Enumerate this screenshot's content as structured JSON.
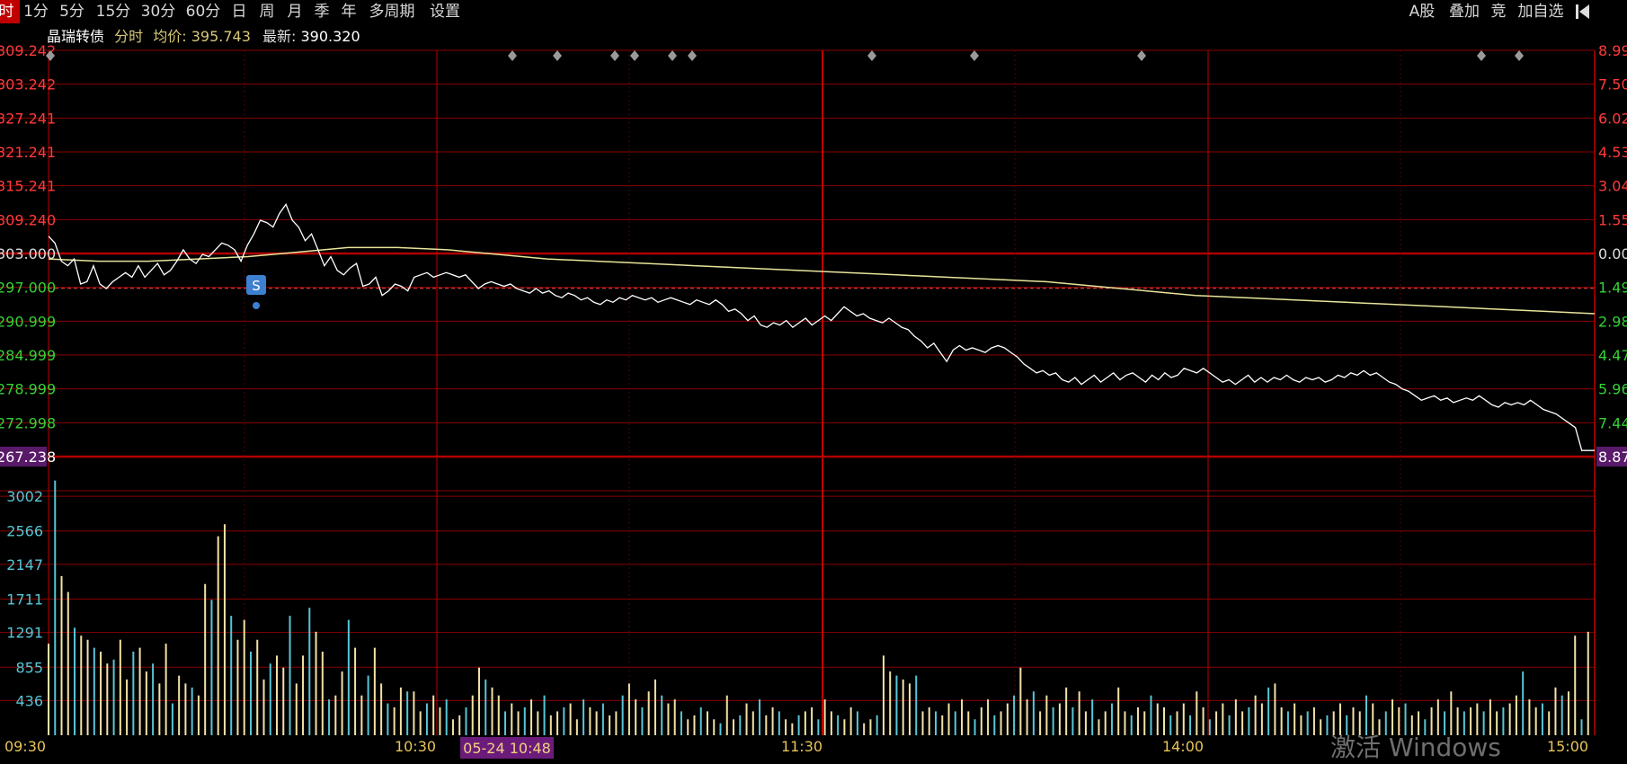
{
  "toolbar": {
    "left": [
      "时",
      "1分",
      "5分",
      "15分",
      "30分",
      "60分",
      "日",
      "周",
      "月",
      "季",
      "年",
      "多周期",
      "设置"
    ],
    "right": [
      "A股",
      "叠加",
      "竞",
      "加自选"
    ],
    "back_icon": "back-to-start-icon"
  },
  "info": {
    "name": "晶瑞转债",
    "mode": "分时",
    "avg_label": "均价:",
    "avg_value": "395.743",
    "last_label": "最新:",
    "last_value": "390.320"
  },
  "badges": {
    "cursor_time": "05-24 10:48",
    "signal": "S"
  },
  "watermark": "激活 Windows",
  "colors": {
    "background": "#000000",
    "grid": "#8b0000",
    "price": "#ffffff",
    "avg": "#e8e49a",
    "up": "#ff3b3b",
    "down": "#35d235",
    "vol_up": "#f3e2a6",
    "vol_down": "#57c6d6"
  },
  "chart_data": {
    "type": "line",
    "price_axis": {
      "ticks": [
        "309.242",
        "303.242",
        "327.241",
        "321.241",
        "315.241",
        "309.240",
        "303.000",
        "297.000",
        "290.999",
        "284.999",
        "278.999",
        "272.998",
        "267.238"
      ],
      "pct_ticks": [
        "8.99",
        "7.50",
        "6.02",
        "4.53",
        "3.04",
        "1.55",
        "0.00",
        "1.49",
        "2.98",
        "4.47",
        "5.96",
        "7.44",
        "8.87"
      ],
      "ylim": [
        -8.87,
        8.99
      ]
    },
    "x_ticks": [
      "09:30",
      "10:30",
      "11:30",
      "14:00",
      "15:00"
    ],
    "volume_ticks": [
      "436",
      "855",
      "1291",
      "1711",
      "2147",
      "2566",
      "3002"
    ],
    "volume_ylim": [
      0,
      3500
    ],
    "series": [
      {
        "name": "分时",
        "values": [
          0.8,
          0.5,
          -0.3,
          -0.5,
          -0.2,
          -1.3,
          -1.2,
          -0.5,
          -1.3,
          -1.5,
          -1.2,
          -1.0,
          -0.8,
          -1.0,
          -0.5,
          -1.0,
          -0.7,
          -0.4,
          -0.9,
          -0.7,
          -0.3,
          0.2,
          -0.2,
          -0.4,
          0.0,
          -0.1,
          0.2,
          0.5,
          0.4,
          0.2,
          -0.3,
          0.4,
          0.9,
          1.5,
          1.4,
          1.2,
          1.8,
          2.2,
          1.5,
          1.2,
          0.6,
          0.9,
          0.2,
          -0.5,
          -0.1,
          -0.7,
          -0.9,
          -0.6,
          -0.4,
          -1.4,
          -1.3,
          -1.0,
          -1.8,
          -1.6,
          -1.3,
          -1.4,
          -1.6,
          -1.0,
          -0.9,
          -0.8,
          -1.0,
          -0.9,
          -0.8,
          -0.9,
          -1.0,
          -0.9,
          -1.2,
          -1.5,
          -1.3,
          -1.2,
          -1.3,
          -1.4,
          -1.3,
          -1.5,
          -1.6,
          -1.7,
          -1.5,
          -1.7,
          -1.6,
          -1.8,
          -1.9,
          -1.7,
          -1.8,
          -2.0,
          -1.9,
          -2.1,
          -2.2,
          -2.0,
          -2.1,
          -1.9,
          -2.0,
          -1.8,
          -1.9,
          -2.0,
          -1.9,
          -2.1,
          -2.0,
          -1.9,
          -2.0,
          -2.1,
          -2.2,
          -2.0,
          -2.1,
          -2.2,
          -2.0,
          -2.2,
          -2.5,
          -2.4,
          -2.6,
          -2.9,
          -2.7,
          -3.1,
          -3.2,
          -3.0,
          -3.1,
          -2.9,
          -3.2,
          -3.0,
          -2.8,
          -3.1,
          -2.9,
          -2.7,
          -2.9,
          -2.6,
          -2.3,
          -2.5,
          -2.7,
          -2.6,
          -2.8,
          -2.9,
          -3.0,
          -2.8,
          -3.0,
          -3.2,
          -3.3,
          -3.6,
          -3.8,
          -4.1,
          -3.9,
          -4.3,
          -4.7,
          -4.2,
          -4.0,
          -4.2,
          -4.1,
          -4.2,
          -4.3,
          -4.1,
          -4.0,
          -4.1,
          -4.3,
          -4.5,
          -4.8,
          -5.0,
          -5.2,
          -5.1,
          -5.3,
          -5.2,
          -5.5,
          -5.6,
          -5.4,
          -5.7,
          -5.5,
          -5.3,
          -5.6,
          -5.4,
          -5.2,
          -5.5,
          -5.3,
          -5.2,
          -5.4,
          -5.6,
          -5.3,
          -5.5,
          -5.2,
          -5.4,
          -5.3,
          -5.0,
          -5.1,
          -5.2,
          -5.0,
          -5.2,
          -5.4,
          -5.6,
          -5.5,
          -5.7,
          -5.5,
          -5.3,
          -5.6,
          -5.4,
          -5.6,
          -5.4,
          -5.5,
          -5.3,
          -5.5,
          -5.6,
          -5.4,
          -5.5,
          -5.4,
          -5.6,
          -5.5,
          -5.3,
          -5.4,
          -5.2,
          -5.3,
          -5.1,
          -5.3,
          -5.2,
          -5.4,
          -5.6,
          -5.7,
          -5.9,
          -6.0,
          -6.2,
          -6.4,
          -6.3,
          -6.2,
          -6.4,
          -6.3,
          -6.5,
          -6.4,
          -6.3,
          -6.4,
          -6.2,
          -6.4,
          -6.6,
          -6.7,
          -6.5,
          -6.6,
          -6.5,
          -6.6,
          -6.4,
          -6.6,
          -6.8,
          -6.9,
          -7.0,
          -7.2,
          -7.4,
          -7.6,
          -8.6,
          -8.6,
          -8.6
        ],
        "role": "price"
      },
      {
        "name": "均价",
        "values": [
          -0.2,
          -0.3,
          -0.3,
          -0.2,
          -0.1,
          0.1,
          0.3,
          0.3,
          0.2,
          0.0,
          -0.2,
          -0.3,
          -0.4,
          -0.5,
          -0.6,
          -0.7,
          -0.8,
          -0.9,
          -1.0,
          -1.1,
          -1.2,
          -1.4,
          -1.6,
          -1.8,
          -1.9,
          -2.0,
          -2.1,
          -2.2,
          -2.3,
          -2.4,
          -2.5,
          -2.6
        ],
        "role": "avg"
      },
      {
        "name": "成交量",
        "role": "volume",
        "values": [
          1150,
          3200,
          2000,
          1800,
          1350,
          1250,
          1200,
          1100,
          1050,
          900,
          950,
          1200,
          700,
          1050,
          1100,
          800,
          900,
          650,
          1150,
          400,
          750,
          650,
          600,
          500,
          1900,
          1700,
          2500,
          2650,
          1500,
          1200,
          1450,
          1050,
          1200,
          700,
          900,
          1000,
          850,
          1500,
          650,
          1000,
          1600,
          1300,
          1050,
          450,
          500,
          800,
          1450,
          1100,
          500,
          750,
          1100,
          650,
          400,
          350,
          600,
          550,
          550,
          300,
          400,
          500,
          350,
          450,
          200,
          250,
          350,
          500,
          850,
          700,
          600,
          500,
          300,
          400,
          300,
          350,
          450,
          300,
          500,
          250,
          300,
          350,
          400,
          200,
          450,
          350,
          300,
          400,
          250,
          300,
          500,
          650,
          450,
          350,
          550,
          700,
          500,
          400,
          450,
          300,
          200,
          250,
          350,
          300,
          200,
          150,
          500,
          200,
          250,
          400,
          300,
          450,
          250,
          350,
          300,
          200,
          150,
          250,
          300,
          350,
          200,
          450,
          300,
          250,
          200,
          350,
          300,
          150,
          200,
          250,
          1000,
          800,
          750,
          700,
          650,
          750,
          300,
          350,
          300,
          250,
          400,
          300,
          450,
          300,
          200,
          350,
          450,
          250,
          300,
          400,
          500,
          850,
          450,
          550,
          300,
          500,
          350,
          400,
          600,
          350,
          550,
          300,
          450,
          200,
          300,
          400,
          600,
          300,
          250,
          350,
          300,
          500,
          400,
          350,
          250,
          300,
          400,
          250,
          550,
          350,
          200,
          300,
          400,
          250,
          450,
          300,
          350,
          500,
          400,
          600,
          650,
          350,
          300,
          400,
          250,
          300,
          350,
          200,
          250,
          300,
          400,
          250,
          350,
          300,
          500,
          400,
          200,
          300,
          450,
          350,
          400,
          250,
          300,
          200,
          350,
          450,
          300,
          550,
          350,
          300,
          350,
          400,
          300,
          450,
          300,
          350,
          400,
          500,
          800,
          450,
          350,
          400,
          300,
          600,
          500,
          550,
          1250,
          200,
          1300
        ]
      }
    ],
    "grid": true,
    "title": "",
    "xlabel": "",
    "ylabel": ""
  }
}
